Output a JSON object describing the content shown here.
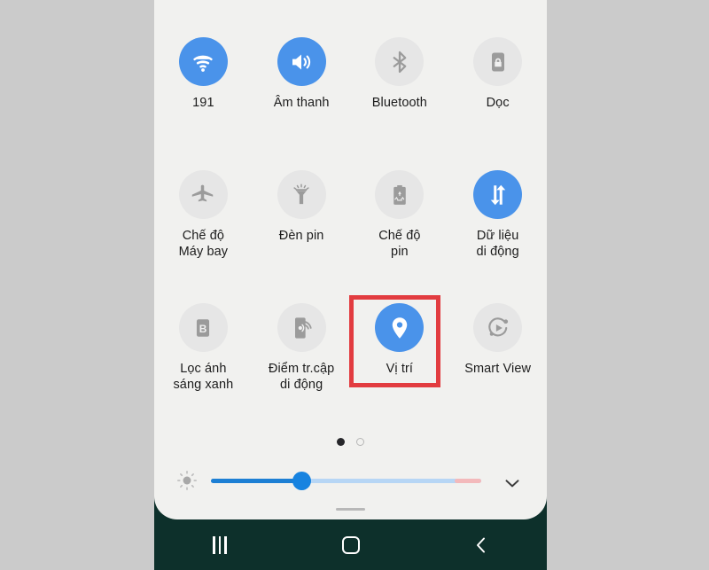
{
  "page": {
    "background_color": "#cbcbcb",
    "panel_color": "#f1f1ef",
    "accent_on_color": "#4a93ea",
    "inactive_color": "#e6e6e6",
    "highlight_color": "#e23c40",
    "navbar_color": "#0d302b"
  },
  "quick_settings": {
    "rows": [
      {
        "tiles": [
          {
            "label": "191",
            "icon": "wifi-icon",
            "state": "on"
          },
          {
            "label": "Âm thanh",
            "icon": "sound-icon",
            "state": "on"
          },
          {
            "label": "Bluetooth",
            "icon": "bluetooth-icon",
            "state": "off"
          },
          {
            "label": "Dọc",
            "icon": "rotation-lock-icon",
            "state": "off"
          }
        ]
      },
      {
        "tiles": [
          {
            "label": "Chế độ\nMáy bay",
            "icon": "airplane-icon",
            "state": "off"
          },
          {
            "label": "Đèn pin",
            "icon": "flashlight-icon",
            "state": "off"
          },
          {
            "label": "Chế độ\npin",
            "icon": "battery-saver-icon",
            "state": "off"
          },
          {
            "label": "Dữ liệu\ndi động",
            "icon": "mobile-data-icon",
            "state": "on"
          }
        ]
      },
      {
        "tiles": [
          {
            "label": "Lọc ánh\nsáng xanh",
            "icon": "blue-light-filter-icon",
            "state": "off"
          },
          {
            "label": "Điểm tr.cập\ndi động",
            "icon": "mobile-hotspot-icon",
            "state": "off"
          },
          {
            "label": "Vị trí",
            "icon": "location-pin-icon",
            "state": "on"
          },
          {
            "label": "Smart View",
            "icon": "smart-view-icon",
            "state": "off"
          }
        ]
      }
    ]
  },
  "pager": {
    "total_pages": 2,
    "current_page": 1
  },
  "brightness": {
    "icon": "brightness-icon",
    "value_percent": 34,
    "expand_icon": "chevron-down-icon"
  },
  "navbar": {
    "recents_label": "Recents",
    "home_label": "Home",
    "back_label": "Back"
  }
}
